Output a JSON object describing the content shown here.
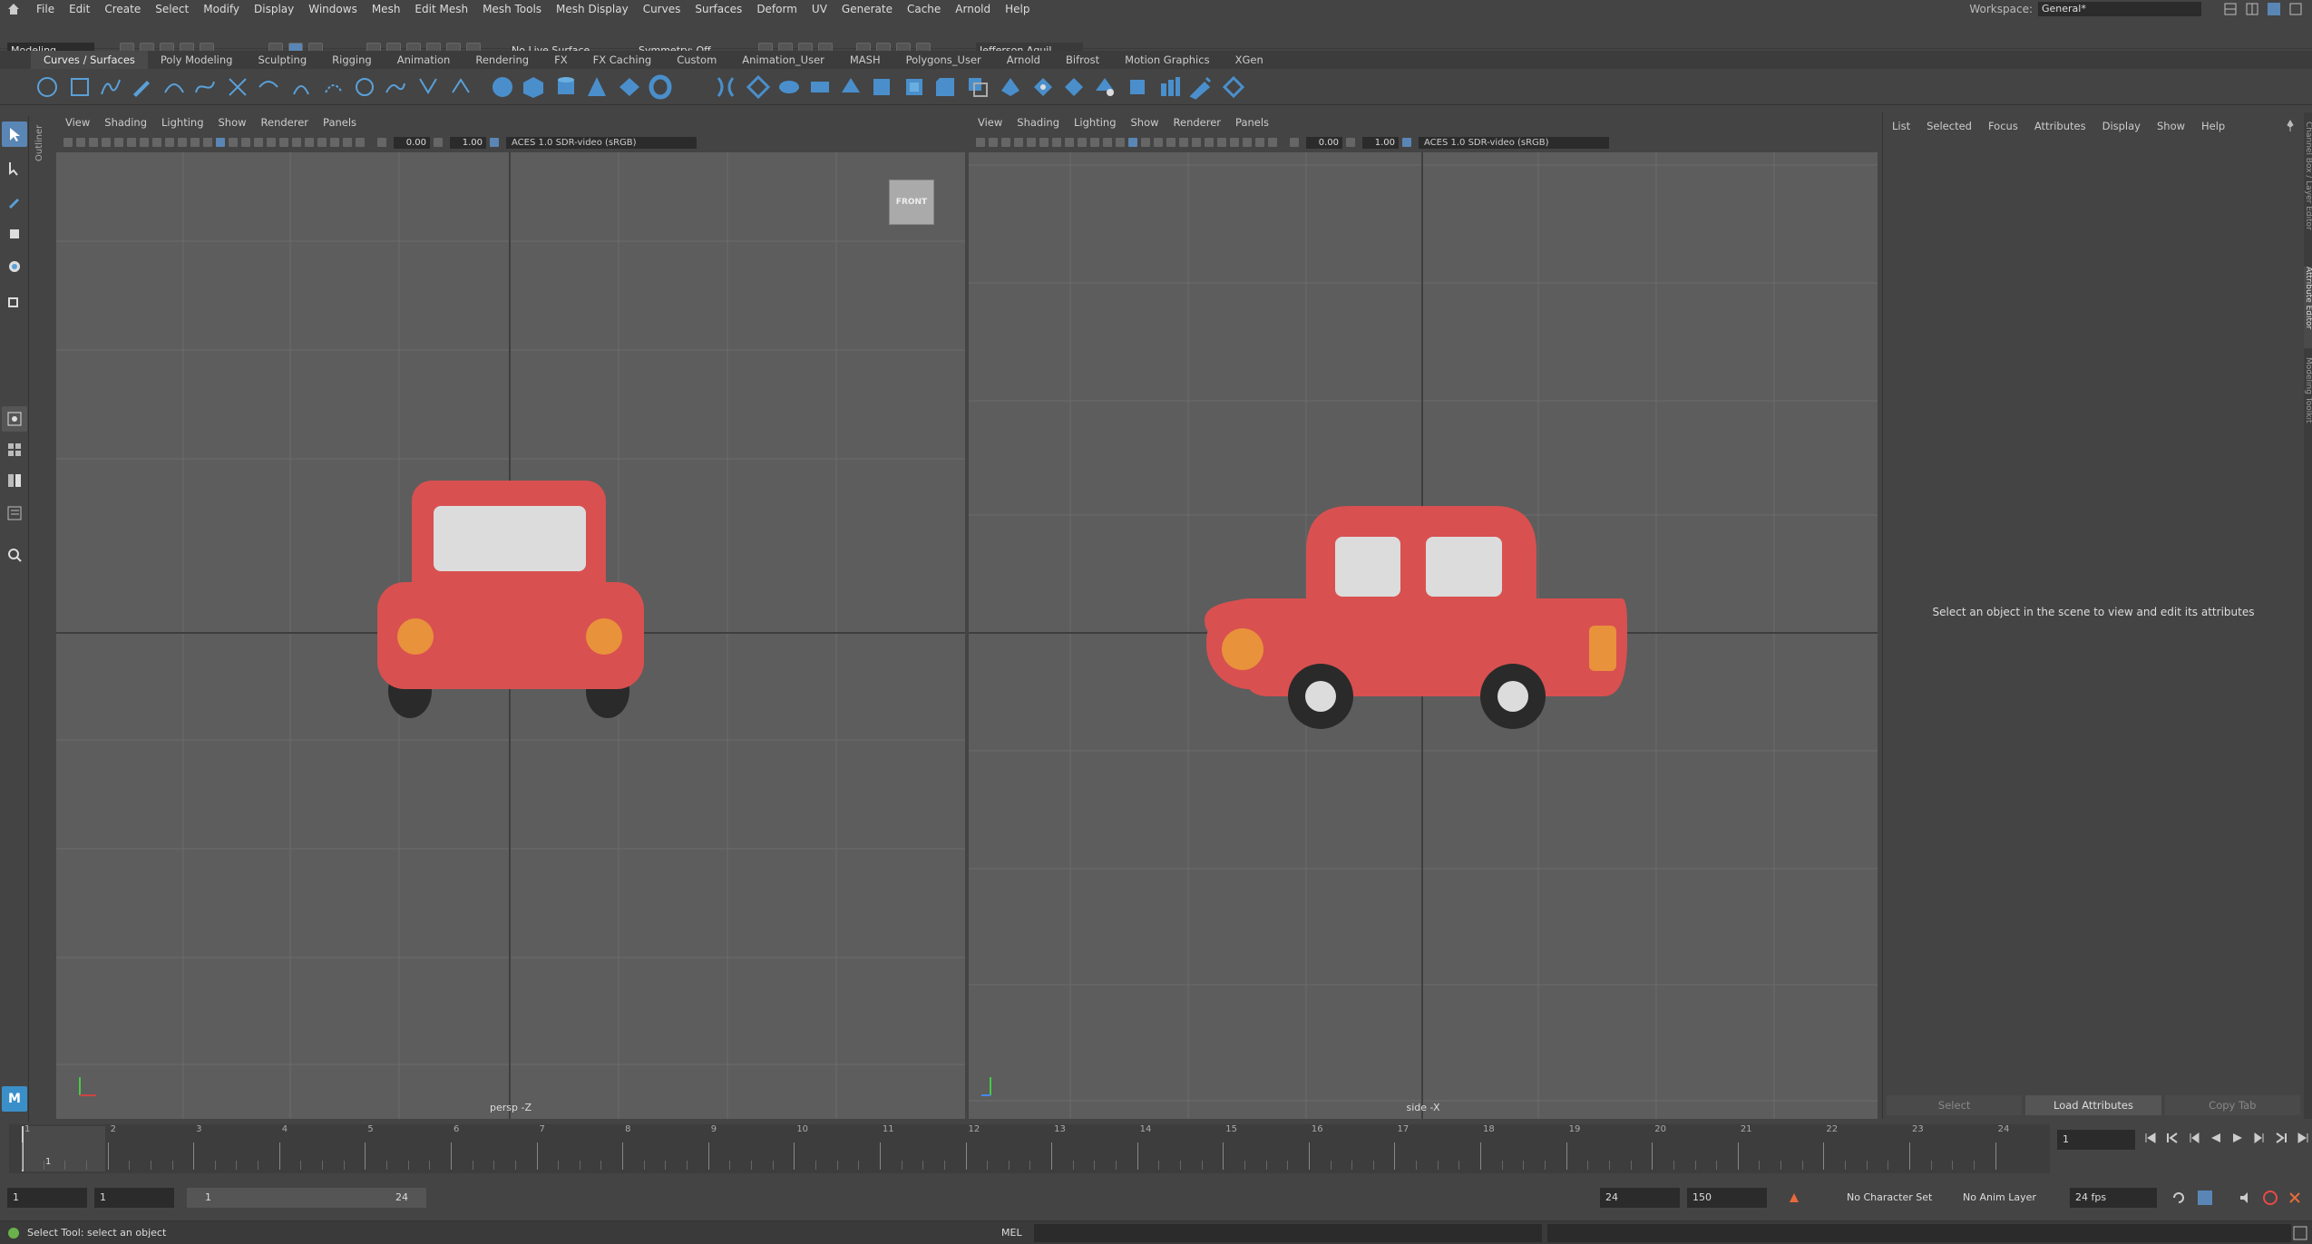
{
  "menubar": {
    "items": [
      "File",
      "Edit",
      "Create",
      "Select",
      "Modify",
      "Display",
      "Windows",
      "Mesh",
      "Edit Mesh",
      "Mesh Tools",
      "Mesh Display",
      "Curves",
      "Surfaces",
      "Deform",
      "UV",
      "Generate",
      "Cache",
      "Arnold",
      "Help"
    ],
    "workspace_label": "Workspace:",
    "workspace_value": "General*"
  },
  "statusline": {
    "mode": "Modeling",
    "live_surface": "No Live Surface",
    "symmetry": "Symmetry: Off",
    "user": "Jefferson Aguil..."
  },
  "shelf_tabs": [
    "Curves / Surfaces",
    "Poly Modeling",
    "Sculpting",
    "Rigging",
    "Animation",
    "Rendering",
    "FX",
    "FX Caching",
    "Custom",
    "Animation_User",
    "MASH",
    "Polygons_User",
    "Arnold",
    "Bifrost",
    "Motion Graphics",
    "XGen"
  ],
  "outliner_label": "Outliner",
  "viewport_left": {
    "menu": [
      "View",
      "Shading",
      "Lighting",
      "Show",
      "Renderer",
      "Panels"
    ],
    "exposure": "0.00",
    "gamma": "1.00",
    "colorspace": "ACES 1.0 SDR-video (sRGB)",
    "camera": "persp -Z",
    "view_cube": "FRONT"
  },
  "viewport_right": {
    "menu": [
      "View",
      "Shading",
      "Lighting",
      "Show",
      "Renderer",
      "Panels"
    ],
    "exposure": "0.00",
    "gamma": "1.00",
    "colorspace": "ACES 1.0 SDR-video (sRGB)",
    "camera": "side -X"
  },
  "attribute_editor": {
    "menu": [
      "List",
      "Selected",
      "Focus",
      "Attributes",
      "Display",
      "Show",
      "Help"
    ],
    "message": "Select an object in the scene to view and edit its attributes",
    "buttons": [
      "Select",
      "Load Attributes",
      "Copy Tab"
    ],
    "side_tabs": [
      "Channel Box / Layer Editor",
      "Attribute Editor",
      "Modeling Toolkit"
    ]
  },
  "timeline": {
    "frames": [
      "1",
      "2",
      "3",
      "4",
      "5",
      "6",
      "7",
      "8",
      "9",
      "10",
      "11",
      "12",
      "13",
      "14",
      "15",
      "16",
      "17",
      "18",
      "19",
      "20",
      "21",
      "22",
      "23",
      "24"
    ],
    "current_frame": "1",
    "current_frame_field": "1"
  },
  "range": {
    "start": "1",
    "start2": "1",
    "slider_start": "1",
    "slider_end": "24",
    "end": "24",
    "end2": "150",
    "character_set": "No Character Set",
    "anim_layer": "No Anim Layer",
    "fps": "24 fps"
  },
  "commandline": {
    "help": "Select Tool: select an object",
    "lang": "MEL"
  },
  "colors": {
    "car_body": "#d95050",
    "window": "#dcdcdc",
    "light": "#e8923c",
    "tire": "#2a2a2a",
    "grid_bg": "#5d5d5d",
    "grid_line": "#6b6b6b",
    "axis_line": "#3a3a3a"
  }
}
